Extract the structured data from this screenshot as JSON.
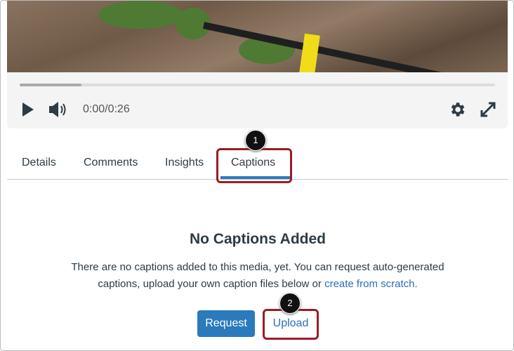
{
  "player": {
    "time": "0:00/0:26",
    "progress_percent": 13
  },
  "tabs": [
    "Details",
    "Comments",
    "Insights",
    "Captions"
  ],
  "active_tab": "Captions",
  "callouts": [
    "1",
    "2"
  ],
  "empty": {
    "title": "No Captions Added",
    "text": "There are no captions added to this media, yet. You can request auto-generated captions, upload your own caption files below or ",
    "link": "create from scratch."
  },
  "buttons": {
    "request": "Request",
    "upload": "Upload"
  },
  "colors": {
    "accent": "#2b7abc",
    "highlight": "#9b1c24"
  }
}
